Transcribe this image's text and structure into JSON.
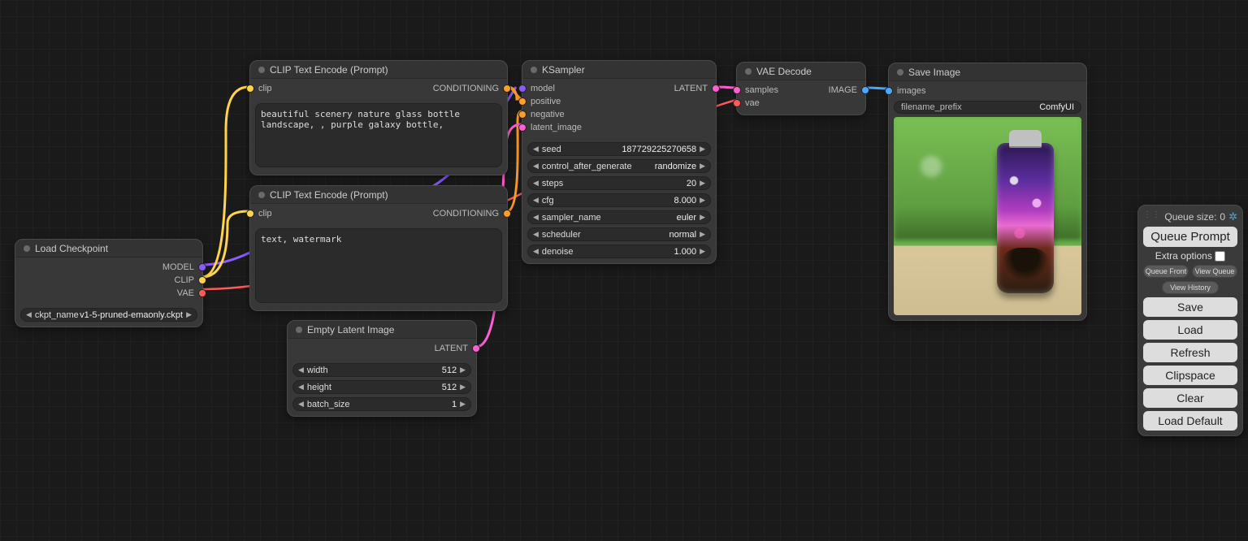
{
  "nodes": {
    "load_checkpoint": {
      "title": "Load Checkpoint",
      "outputs": {
        "model": "MODEL",
        "clip": "CLIP",
        "vae": "VAE"
      },
      "params": {
        "ckpt_name_label": "ckpt_name",
        "ckpt_name_value": "v1-5-pruned-emaonly.ckpt"
      }
    },
    "clip_pos": {
      "title": "CLIP Text Encode (Prompt)",
      "inputs": {
        "clip": "clip"
      },
      "outputs": {
        "conditioning": "CONDITIONING"
      },
      "text": "beautiful scenery nature glass bottle landscape, , purple galaxy bottle,"
    },
    "clip_neg": {
      "title": "CLIP Text Encode (Prompt)",
      "inputs": {
        "clip": "clip"
      },
      "outputs": {
        "conditioning": "CONDITIONING"
      },
      "text": "text, watermark"
    },
    "empty_latent": {
      "title": "Empty Latent Image",
      "outputs": {
        "latent": "LATENT"
      },
      "params": {
        "width_label": "width",
        "width_value": "512",
        "height_label": "height",
        "height_value": "512",
        "batch_label": "batch_size",
        "batch_value": "1"
      }
    },
    "ksampler": {
      "title": "KSampler",
      "inputs": {
        "model": "model",
        "positive": "positive",
        "negative": "negative",
        "latent_image": "latent_image"
      },
      "outputs": {
        "latent": "LATENT"
      },
      "params": {
        "seed_label": "seed",
        "seed_value": "187729225270658",
        "cag_label": "control_after_generate",
        "cag_value": "randomize",
        "steps_label": "steps",
        "steps_value": "20",
        "cfg_label": "cfg",
        "cfg_value": "8.000",
        "sampler_label": "sampler_name",
        "sampler_value": "euler",
        "scheduler_label": "scheduler",
        "scheduler_value": "normal",
        "denoise_label": "denoise",
        "denoise_value": "1.000"
      }
    },
    "vae_decode": {
      "title": "VAE Decode",
      "inputs": {
        "samples": "samples",
        "vae": "vae"
      },
      "outputs": {
        "image": "IMAGE"
      }
    },
    "save_image": {
      "title": "Save Image",
      "inputs": {
        "images": "images"
      },
      "params": {
        "prefix_label": "filename_prefix",
        "prefix_value": "ComfyUI"
      }
    }
  },
  "panel": {
    "queue_size_label": "Queue size:",
    "queue_size_value": "0",
    "queue_prompt": "Queue Prompt",
    "extra_options": "Extra options",
    "queue_front": "Queue Front",
    "view_queue": "View Queue",
    "view_history": "View History",
    "save": "Save",
    "load": "Load",
    "refresh": "Refresh",
    "clipspace": "Clipspace",
    "clear": "Clear",
    "load_default": "Load Default"
  }
}
